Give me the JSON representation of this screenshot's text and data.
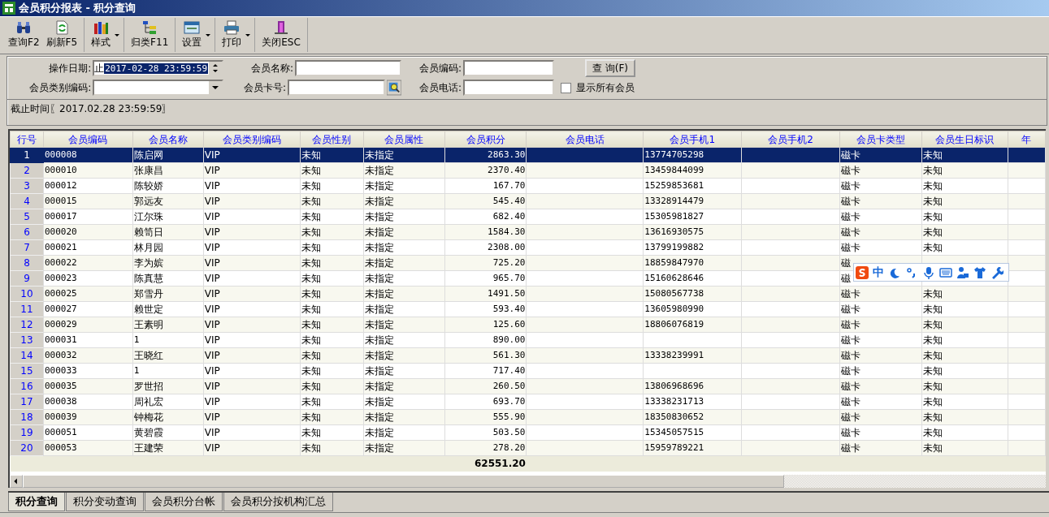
{
  "window": {
    "title": "会员积分报表 - 积分查询"
  },
  "toolbar": [
    {
      "label": "查询F2",
      "kind": "binoculars",
      "dropdown": false
    },
    {
      "label": "刷新F5",
      "kind": "refresh",
      "dropdown": false
    },
    {
      "label": "样式",
      "kind": "books",
      "dropdown": true
    },
    {
      "label": "归类F11",
      "kind": "tree",
      "dropdown": false
    },
    {
      "label": "设置",
      "kind": "window",
      "dropdown": true
    },
    {
      "label": "打印",
      "kind": "printer",
      "dropdown": true
    },
    {
      "label": "关闭ESC",
      "kind": "exit",
      "dropdown": false
    }
  ],
  "filters": [
    {
      "kind": "datetime",
      "label": "操作日期:",
      "prefix": "止",
      "value": "2017-02-28 23:59:59"
    },
    {
      "kind": "text",
      "label": "会员名称:"
    },
    {
      "kind": "text",
      "label": "会员编码:"
    },
    {
      "kind": "button",
      "label": "查 询(F)"
    },
    {
      "kind": "combo",
      "label": "会员类别编码:"
    },
    {
      "kind": "lookup",
      "label": "会员卡号:"
    },
    {
      "kind": "text",
      "label": "会员电话:"
    },
    {
      "kind": "checkbox",
      "label": "显示所有会员",
      "checked": false
    }
  ],
  "note": "截止时间〖2017.02.28 23:59:59〗",
  "table": {
    "columns": [
      "行号",
      "会员编码",
      "会员名称",
      "会员类别编码",
      "会员性别",
      "会员属性",
      "会员积分",
      "会员电话",
      "会员手机1",
      "会员手机2",
      "会员卡类型",
      "会员生日标识",
      "年"
    ],
    "rows": [
      {
        "selected": true,
        "cells": [
          "1",
          "000008",
          "陈启网",
          "VIP",
          "未知",
          "未指定",
          "2863.30",
          null,
          "13774705298",
          null,
          "磁卡",
          "未知",
          null
        ]
      },
      {
        "selected": false,
        "cells": [
          "2",
          "000010",
          "张康昌",
          "VIP",
          "未知",
          "未指定",
          "2370.40",
          null,
          "13459844099",
          null,
          "磁卡",
          "未知",
          null
        ]
      },
      {
        "selected": false,
        "cells": [
          "3",
          "000012",
          "陈较娇",
          "VIP",
          "未知",
          "未指定",
          "167.70",
          null,
          "15259853681",
          null,
          "磁卡",
          "未知",
          null
        ]
      },
      {
        "selected": false,
        "cells": [
          "4",
          "000015",
          "郭远友",
          "VIP",
          "未知",
          "未指定",
          "545.40",
          null,
          "13328914479",
          null,
          "磁卡",
          "未知",
          null
        ]
      },
      {
        "selected": false,
        "cells": [
          "5",
          "000017",
          "江尔珠",
          "VIP",
          "未知",
          "未指定",
          "682.40",
          null,
          "15305981827",
          null,
          "磁卡",
          "未知",
          null
        ]
      },
      {
        "selected": false,
        "cells": [
          "6",
          "000020",
          "赖笥日",
          "VIP",
          "未知",
          "未指定",
          "1584.30",
          null,
          "13616930575",
          null,
          "磁卡",
          "未知",
          null
        ]
      },
      {
        "selected": false,
        "cells": [
          "7",
          "000021",
          "林月园",
          "VIP",
          "未知",
          "未指定",
          "2308.00",
          null,
          "13799199882",
          null,
          "磁卡",
          "未知",
          null
        ]
      },
      {
        "selected": false,
        "cells": [
          "8",
          "000022",
          "李为嫔",
          "VIP",
          "未知",
          "未指定",
          "725.20",
          null,
          "18859847970",
          null,
          "磁",
          null,
          null
        ]
      },
      {
        "selected": false,
        "cells": [
          "9",
          "000023",
          "陈真慧",
          "VIP",
          "未知",
          "未指定",
          "965.70",
          null,
          "15160628646",
          null,
          "磁",
          null,
          null
        ]
      },
      {
        "selected": false,
        "cells": [
          "10",
          "000025",
          "郑雪丹",
          "VIP",
          "未知",
          "未指定",
          "1491.50",
          null,
          "15080567738",
          null,
          "磁卡",
          "未知",
          null
        ]
      },
      {
        "selected": false,
        "cells": [
          "11",
          "000027",
          "赖世定",
          "VIP",
          "未知",
          "未指定",
          "593.40",
          null,
          "13605980990",
          null,
          "磁卡",
          "未知",
          null
        ]
      },
      {
        "selected": false,
        "cells": [
          "12",
          "000029",
          "王素明",
          "VIP",
          "未知",
          "未指定",
          "125.60",
          null,
          "18806076819",
          null,
          "磁卡",
          "未知",
          null
        ]
      },
      {
        "selected": false,
        "cells": [
          "13",
          "000031",
          "1",
          "VIP",
          "未知",
          "未指定",
          "890.00",
          null,
          null,
          null,
          "磁卡",
          "未知",
          null
        ]
      },
      {
        "selected": false,
        "cells": [
          "14",
          "000032",
          "王晓红",
          "VIP",
          "未知",
          "未指定",
          "561.30",
          null,
          "13338239991",
          null,
          "磁卡",
          "未知",
          null
        ]
      },
      {
        "selected": false,
        "cells": [
          "15",
          "000033",
          "1",
          "VIP",
          "未知",
          "未指定",
          "717.40",
          null,
          null,
          null,
          "磁卡",
          "未知",
          null
        ]
      },
      {
        "selected": false,
        "cells": [
          "16",
          "000035",
          "罗世招",
          "VIP",
          "未知",
          "未指定",
          "260.50",
          null,
          "13806968696",
          null,
          "磁卡",
          "未知",
          null
        ]
      },
      {
        "selected": false,
        "cells": [
          "17",
          "000038",
          "周礼宏",
          "VIP",
          "未知",
          "未指定",
          "693.70",
          null,
          "13338231713",
          null,
          "磁卡",
          "未知",
          null
        ]
      },
      {
        "selected": false,
        "cells": [
          "18",
          "000039",
          "钟梅花",
          "VIP",
          "未知",
          "未指定",
          "555.90",
          null,
          "18350830652",
          null,
          "磁卡",
          "未知",
          null
        ]
      },
      {
        "selected": false,
        "cells": [
          "19",
          "000051",
          "黄碧霞",
          "VIP",
          "未知",
          "未指定",
          "503.50",
          null,
          "15345057515",
          null,
          "磁卡",
          "未知",
          null
        ]
      },
      {
        "selected": false,
        "cells": [
          "20",
          "000053",
          "王建荣",
          "VIP",
          "未知",
          "未指定",
          "278.20",
          null,
          "15959789221",
          null,
          "磁卡",
          "未知",
          null
        ]
      }
    ],
    "summary": {
      "points_total": "62551.20"
    }
  },
  "tabs": [
    {
      "label": "积分查询",
      "selected": true
    },
    {
      "label": "积分变动查询",
      "selected": false
    },
    {
      "label": "会员积分台帐",
      "selected": false
    },
    {
      "label": "会员积分按机构汇总",
      "selected": false
    }
  ],
  "ime_bar": {
    "mode": "中"
  }
}
